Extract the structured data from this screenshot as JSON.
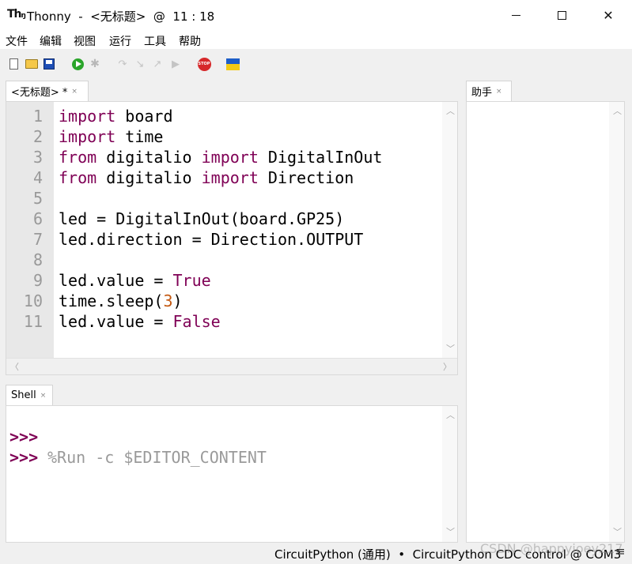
{
  "window": {
    "title": "Thonny  -  <无标题>  @  11 : 18",
    "minimize_label": "–",
    "maximize_label": "□",
    "close_label": "✕"
  },
  "menu": [
    "文件",
    "编辑",
    "视图",
    "运行",
    "工具",
    "帮助"
  ],
  "toolbar": {
    "stop_label": "STOP",
    "debug_glyph": "✱",
    "step_over_glyph": "↷",
    "step_into_glyph": "↘",
    "step_out_glyph": "↗",
    "resume_glyph": "▶"
  },
  "editor": {
    "tab_label": "<无标题> *",
    "tab_close": "×",
    "lines": [
      {
        "n": "1",
        "parts": [
          {
            "t": "import",
            "k": "kw"
          },
          {
            "t": " board",
            "k": ""
          }
        ]
      },
      {
        "n": "2",
        "parts": [
          {
            "t": "import",
            "k": "kw"
          },
          {
            "t": " time",
            "k": ""
          }
        ]
      },
      {
        "n": "3",
        "parts": [
          {
            "t": "from",
            "k": "kw"
          },
          {
            "t": " digitalio ",
            "k": ""
          },
          {
            "t": "import",
            "k": "kw"
          },
          {
            "t": " DigitalInOut",
            "k": ""
          }
        ]
      },
      {
        "n": "4",
        "parts": [
          {
            "t": "from",
            "k": "kw"
          },
          {
            "t": " digitalio ",
            "k": ""
          },
          {
            "t": "import",
            "k": "kw"
          },
          {
            "t": " Direction",
            "k": ""
          }
        ]
      },
      {
        "n": "5",
        "parts": []
      },
      {
        "n": "6",
        "parts": [
          {
            "t": "led = DigitalInOut(board.GP25)",
            "k": ""
          }
        ]
      },
      {
        "n": "7",
        "parts": [
          {
            "t": "led.direction = Direction.OUTPUT",
            "k": ""
          }
        ]
      },
      {
        "n": "8",
        "parts": []
      },
      {
        "n": "9",
        "parts": [
          {
            "t": "led.value = ",
            "k": ""
          },
          {
            "t": "True",
            "k": "kw"
          }
        ]
      },
      {
        "n": "10",
        "parts": [
          {
            "t": "time.sleep(",
            "k": ""
          },
          {
            "t": "3",
            "k": "num"
          },
          {
            "t": ")",
            "k": ""
          }
        ]
      },
      {
        "n": "11",
        "parts": [
          {
            "t": "led.value = ",
            "k": ""
          },
          {
            "t": "False",
            "k": "kw"
          }
        ]
      }
    ]
  },
  "shell": {
    "tab_label": "Shell",
    "tab_close": "×",
    "prompt": ">>>",
    "command": "%Run -c $EDITOR_CONTENT"
  },
  "assistant": {
    "tab_label": "助手",
    "tab_close": "×"
  },
  "status": {
    "text": "CircuitPython (通用)  •  CircuitPython CDC control @ COM3",
    "menu_glyph": "≡",
    "watermark": "CSDN @happyjoey217"
  },
  "colors": {
    "keyword": "#7f0055",
    "number": "#c45912",
    "gutter": "#e8e8e8"
  }
}
